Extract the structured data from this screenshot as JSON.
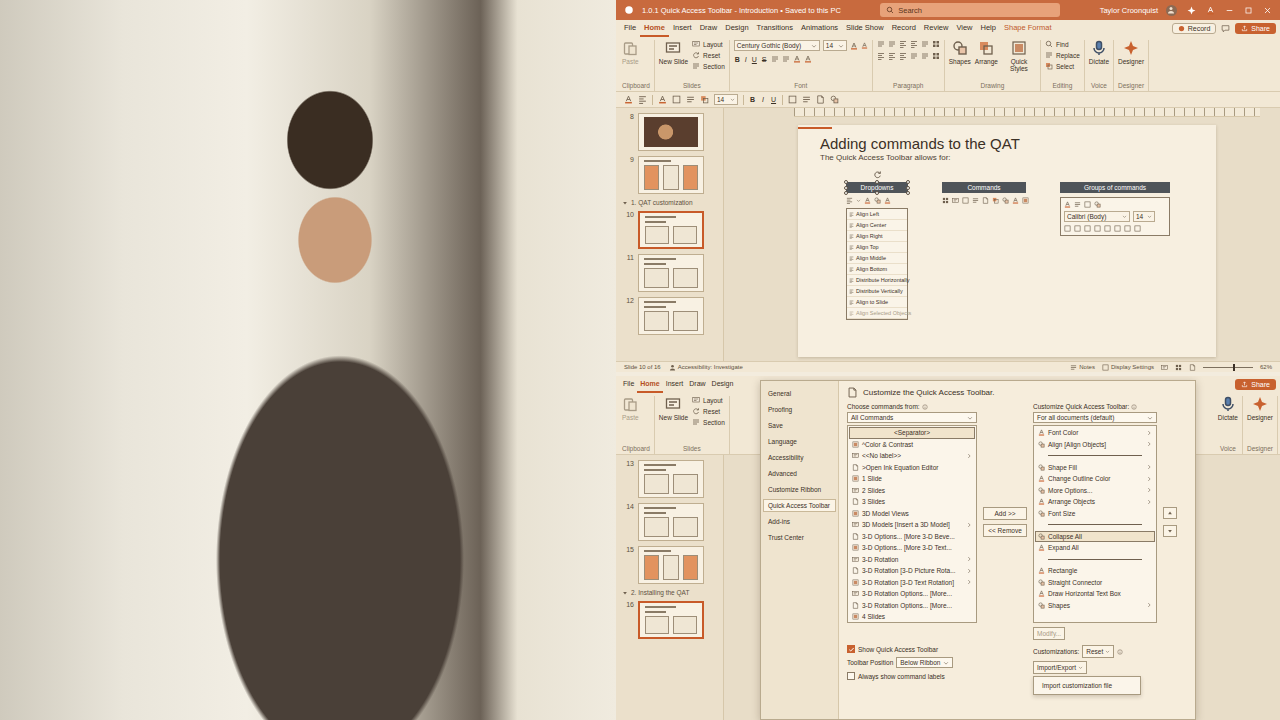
{
  "top_window": {
    "title": "1.0.1 Quick Access Toolbar - Introduction • Saved to this PC",
    "search": {
      "placeholder": "Search"
    },
    "user": "Taylor Croonquist",
    "record_button": "Record",
    "share_button": "Share",
    "tabs": [
      {
        "label": "File",
        "selected": false,
        "contextual": false
      },
      {
        "label": "Home",
        "selected": true,
        "contextual": false
      },
      {
        "label": "Insert",
        "selected": false,
        "contextual": false
      },
      {
        "label": "Draw",
        "selected": false,
        "contextual": false
      },
      {
        "label": "Design",
        "selected": false,
        "contextual": false
      },
      {
        "label": "Transitions",
        "selected": false,
        "contextual": false
      },
      {
        "label": "Animations",
        "selected": false,
        "contextual": false
      },
      {
        "label": "Slide Show",
        "selected": false,
        "contextual": false
      },
      {
        "label": "Record",
        "selected": false,
        "contextual": false
      },
      {
        "label": "Review",
        "selected": false,
        "contextual": false
      },
      {
        "label": "View",
        "selected": false,
        "contextual": false
      },
      {
        "label": "Help",
        "selected": false,
        "contextual": false
      },
      {
        "label": "Shape Format",
        "selected": false,
        "contextual": true
      }
    ],
    "ribbon_groups": [
      {
        "label": "Clipboard",
        "kind": "buttons",
        "big": [
          {
            "label": "Paste",
            "disabled": true
          }
        ],
        "small": []
      },
      {
        "label": "Slides",
        "kind": "buttons",
        "big": [
          {
            "label": "New Slide",
            "disabled": false
          }
        ],
        "small": [
          "Layout",
          "Reset",
          "Section"
        ]
      },
      {
        "label": "Font",
        "kind": "font",
        "font_name": "Century Gothic (Body)",
        "font_size": "14",
        "format_buttons": [
          "B",
          "I",
          "U",
          "S"
        ]
      },
      {
        "label": "Paragraph",
        "kind": "paragraph"
      },
      {
        "label": "Drawing",
        "kind": "buttons",
        "big": [
          {
            "label": "Shapes",
            "disabled": false
          },
          {
            "label": "Arrange",
            "disabled": false
          },
          {
            "label": "Quick Styles",
            "disabled": false
          }
        ],
        "small": []
      },
      {
        "label": "Editing",
        "kind": "buttons",
        "big": [],
        "small": [
          "Find",
          "Replace",
          "Select"
        ]
      },
      {
        "label": "Voice",
        "kind": "buttons",
        "big": [
          {
            "label": "Dictate",
            "disabled": false
          }
        ],
        "small": []
      },
      {
        "label": "Designer",
        "kind": "buttons",
        "big": [
          {
            "label": "Designer",
            "disabled": false
          }
        ],
        "small": []
      }
    ],
    "qat": {
      "font_size": "14",
      "format_buttons": [
        "B",
        "I",
        "U"
      ]
    },
    "slides": [
      {
        "kind": "slide",
        "number": "8",
        "selected": false,
        "thumb": "photo"
      },
      {
        "kind": "slide",
        "number": "9",
        "selected": false,
        "thumb": "diagram"
      },
      {
        "kind": "section",
        "label": "1. QAT customization"
      },
      {
        "kind": "slide",
        "number": "10",
        "selected": true,
        "thumb": "table"
      },
      {
        "kind": "slide",
        "number": "11",
        "selected": false,
        "thumb": "table"
      },
      {
        "kind": "slide",
        "number": "12",
        "selected": false,
        "thumb": "table"
      }
    ],
    "slide": {
      "title": "Adding commands to the QAT",
      "subtitle": "The Quick Access Toolbar allows for:",
      "columns": [
        {
          "label": "Dropdowns",
          "selected": true,
          "kind": "dropdown"
        },
        {
          "label": "Commands",
          "selected": false,
          "kind": "commands"
        },
        {
          "label": "Groups of commands",
          "selected": false,
          "kind": "group"
        }
      ],
      "dropdown_items": [
        {
          "label": "Align Left",
          "disabled": false
        },
        {
          "label": "Align Center",
          "disabled": false
        },
        {
          "label": "Align Right",
          "disabled": false
        },
        {
          "label": "Align Top",
          "disabled": false
        },
        {
          "label": "Align Middle",
          "disabled": false
        },
        {
          "label": "Align Bottom",
          "disabled": false
        },
        {
          "label": "Distribute Horizontally",
          "disabled": false
        },
        {
          "label": "Distribute Vertically",
          "disabled": false
        },
        {
          "label": "Align to Slide",
          "disabled": false
        },
        {
          "label": "Align Selected Objects",
          "disabled": true
        }
      ],
      "group_panel": {
        "font_name": "Calibri (Body)",
        "font_size": "14"
      }
    },
    "status_bar": {
      "slide": "Slide 10 of 16",
      "accessibility": "Accessibility: Investigate",
      "notes": "Notes",
      "display": "Display Settings",
      "zoom": "62%",
      "zoom_level": 0.6
    }
  },
  "bottom_window": {
    "tabs": [
      {
        "label": "File",
        "selected": false
      },
      {
        "label": "Home",
        "selected": true
      },
      {
        "label": "Insert",
        "selected": false
      },
      {
        "label": "Draw",
        "selected": false
      },
      {
        "label": "Design",
        "selected": false
      }
    ],
    "share_button": "Share",
    "ribbon_groups_left": [
      {
        "label": "Clipboard",
        "kind": "buttons",
        "big": [
          {
            "label": "Paste",
            "disabled": true
          }
        ],
        "small": []
      },
      {
        "label": "Slides",
        "kind": "buttons",
        "big": [
          {
            "label": "New Slide",
            "disabled": false
          }
        ],
        "small": [
          "Layout",
          "Reset",
          "Section"
        ]
      }
    ],
    "ribbon_groups_right": [
      {
        "label": "Voice",
        "kind": "buttons",
        "big": [
          {
            "label": "Dictate",
            "disabled": false
          }
        ],
        "small": []
      },
      {
        "label": "Designer",
        "kind": "buttons",
        "big": [
          {
            "label": "Designer",
            "disabled": false
          }
        ],
        "small": []
      }
    ],
    "slides": [
      {
        "kind": "slide",
        "number": "13",
        "selected": false,
        "thumb": "table"
      },
      {
        "kind": "slide",
        "number": "14",
        "selected": false,
        "thumb": "table"
      },
      {
        "kind": "slide",
        "number": "15",
        "selected": false,
        "thumb": "diagram"
      },
      {
        "kind": "section",
        "label": "2. Installing the QAT"
      },
      {
        "kind": "slide",
        "number": "16",
        "selected": true,
        "thumb": "table"
      }
    ]
  },
  "options_dialog": {
    "sidebar": [
      {
        "label": "General",
        "selected": false
      },
      {
        "label": "Proofing",
        "selected": false
      },
      {
        "label": "Save",
        "selected": false
      },
      {
        "label": "Language",
        "selected": false
      },
      {
        "label": "Accessibility",
        "selected": false
      },
      {
        "label": "Advanced",
        "selected": false
      },
      {
        "label": "Customize Ribbon",
        "selected": false
      },
      {
        "label": "Quick Access Toolbar",
        "selected": true
      },
      {
        "label": "Add-ins",
        "selected": false
      },
      {
        "label": "Trust Center",
        "selected": false
      }
    ],
    "heading": "Customize the Quick Access Toolbar.",
    "choose_label": "Choose commands from:",
    "choose_value": "All Commands",
    "available_commands": [
      {
        "label": "<Separator>",
        "submenu": false,
        "selected": true
      },
      {
        "label": "^Color & Contrast",
        "submenu": false,
        "selected": false
      },
      {
        "label": "<<No label>>",
        "submenu": true,
        "selected": false
      },
      {
        "label": ">Open Ink Equation Editor",
        "submenu": false,
        "selected": false
      },
      {
        "label": "1 Slide",
        "submenu": false,
        "selected": false
      },
      {
        "label": "2 Slides",
        "submenu": false,
        "selected": false
      },
      {
        "label": "3 Slides",
        "submenu": false,
        "selected": false
      },
      {
        "label": "3D Model Views",
        "submenu": false,
        "selected": false
      },
      {
        "label": "3D Models [Insert a 3D Model]",
        "submenu": true,
        "selected": false
      },
      {
        "label": "3-D Options... [More 3-D Beve...",
        "submenu": false,
        "selected": false
      },
      {
        "label": "3-D Options... [More 3-D Text...",
        "submenu": false,
        "selected": false
      },
      {
        "label": "3-D Rotation",
        "submenu": true,
        "selected": false
      },
      {
        "label": "3-D Rotation [3-D Picture Rota...",
        "submenu": true,
        "selected": false
      },
      {
        "label": "3-D Rotation [3-D Text Rotation]",
        "submenu": true,
        "selected": false
      },
      {
        "label": "3-D Rotation Options... [More...",
        "submenu": false,
        "selected": false
      },
      {
        "label": "3-D Rotation Options... [More...",
        "submenu": false,
        "selected": false
      },
      {
        "label": "4 Slides",
        "submenu": false,
        "selected": false
      }
    ],
    "add_button": "Add >>",
    "remove_button": "<< Remove",
    "toolbar_label": "Customize Quick Access Toolbar:",
    "toolbar_value": "For all documents (default)",
    "toolbar_commands": [
      {
        "kind": "command",
        "label": "Font Color",
        "submenu": true,
        "selected": false
      },
      {
        "kind": "command",
        "label": "Align [Align Objects]",
        "submenu": true,
        "selected": false
      },
      {
        "kind": "separator",
        "selected": false
      },
      {
        "kind": "command",
        "label": "Shape Fill",
        "submenu": true,
        "selected": false
      },
      {
        "kind": "command",
        "label": "Change Outline Color",
        "submenu": true,
        "selected": false
      },
      {
        "kind": "command",
        "label": "More Options...",
        "submenu": true,
        "selected": false
      },
      {
        "kind": "command",
        "label": "Arrange Objects",
        "submenu": true,
        "selected": false
      },
      {
        "kind": "command",
        "label": "Font Size",
        "submenu": false,
        "selected": false
      },
      {
        "kind": "separator",
        "selected": false
      },
      {
        "kind": "command",
        "label": "Collapse All",
        "submenu": false,
        "selected": true
      },
      {
        "kind": "command",
        "label": "Expand All",
        "submenu": false,
        "selected": false
      },
      {
        "kind": "separator",
        "selected": false
      },
      {
        "kind": "command",
        "label": "Rectangle",
        "submenu": false,
        "selected": false
      },
      {
        "kind": "command",
        "label": "Straight Connector",
        "submenu": false,
        "selected": false
      },
      {
        "kind": "command",
        "label": "Draw Horizontal Text Box",
        "submenu": false,
        "selected": false
      },
      {
        "kind": "command",
        "label": "Shapes",
        "submenu": true,
        "selected": false
      }
    ],
    "modify_button": {
      "label": "Modify...",
      "disabled": true
    },
    "show_toolbar": {
      "label": "Show Quick Access Toolbar",
      "checked": true
    },
    "position_label": "Toolbar Position",
    "position_value": "Below Ribbon",
    "always_labels": {
      "label": "Always show command labels",
      "checked": false
    },
    "customizations_label": "Customizations:",
    "reset_button": "Reset",
    "import_export_button": "Import/Export",
    "import_menu": [
      "Import customization file"
    ]
  }
}
